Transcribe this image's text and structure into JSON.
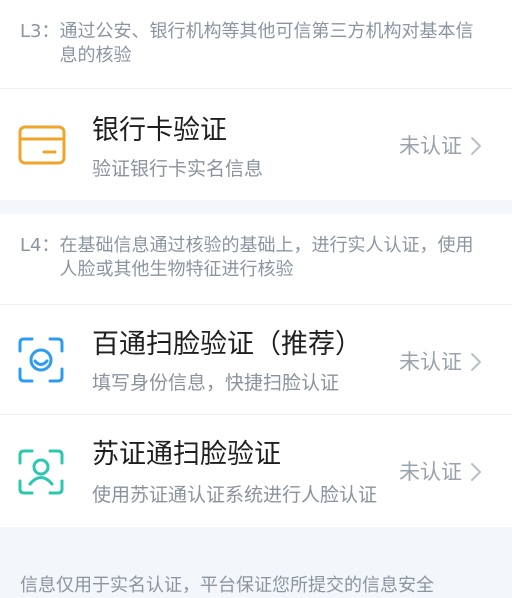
{
  "sections": [
    {
      "prefix": "L3：",
      "text": "通过公安、银行机构等其他可信第三方机构对基本信息的核验"
    },
    {
      "prefix": "L4：",
      "text": "在基础信息通过核验的基础上，进行实人认证，使用人脸或其他生物特征进行核验"
    }
  ],
  "items": [
    {
      "icon": "bank-card-icon",
      "title": "银行卡验证",
      "subtitle": "验证银行卡实名信息",
      "status": "未认证"
    },
    {
      "icon": "face-scan-icon",
      "title": "百通扫脸验证（推荐）",
      "subtitle": "填写身份信息，快捷扫脸认证",
      "status": "未认证"
    },
    {
      "icon": "user-scan-icon",
      "title": "苏证通扫脸验证",
      "subtitle": "使用苏证通认证系统进行人脸认证",
      "status": "未认证"
    }
  ],
  "footer": {
    "text": "信息仅用于实名认证，平台保证您所提交的信息安全"
  },
  "colors": {
    "background": "#f3f6fa",
    "card_icon": "#f0a52a",
    "face_icon": "#2d9cf0",
    "teal_icon": "#2cc7b0",
    "title": "#1f1f1f",
    "subtext": "#8a939d",
    "status": "#9aa3ad"
  }
}
